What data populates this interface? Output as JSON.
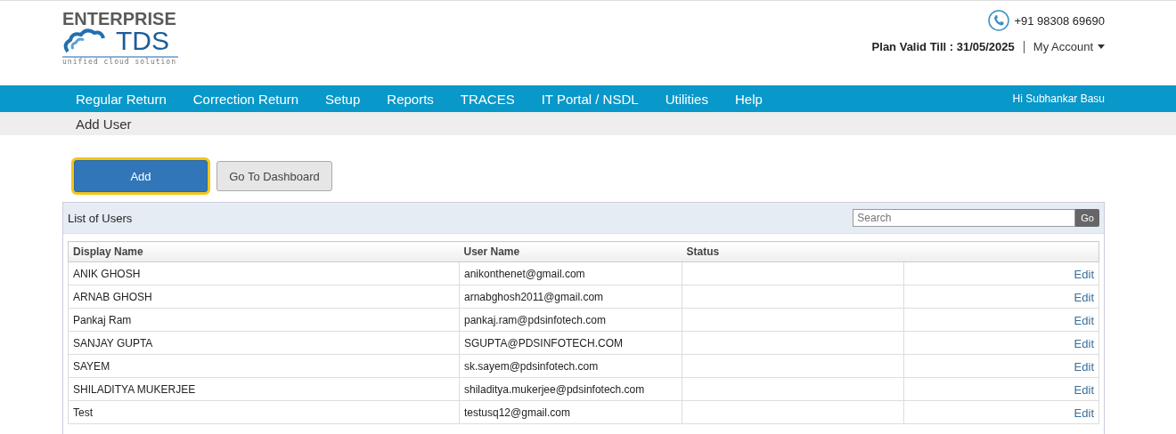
{
  "logo": {
    "line_1": "ENTERPRISE",
    "line_2": "TDS",
    "tagline": "unified cloud solution"
  },
  "contact": {
    "phone": "+91 98308 69690",
    "plan": "Plan Valid Till : 31/05/2025",
    "account": "My Account"
  },
  "nav": {
    "items": [
      "Regular Return",
      "Correction Return",
      "Setup",
      "Reports",
      "TRACES",
      "IT Portal / NSDL",
      "Utilities",
      "Help"
    ],
    "greeting": "Hi Subhankar Basu"
  },
  "breadcrumb": "Add User",
  "buttons": [
    {
      "label": "Add",
      "kind": "primary",
      "highlighted": true
    },
    {
      "label": "Go To Dashboard",
      "kind": "default",
      "highlighted": false
    }
  ],
  "panel": {
    "title": "List of Users",
    "search_placeholder": "Search",
    "search_button": "Go"
  },
  "table": {
    "columns": [
      "Display Name",
      "User Name",
      "Status"
    ],
    "rows": [
      {
        "display_name": "ANIK GHOSH",
        "user_name": "anikonthenet@gmail.com",
        "action": "Edit"
      },
      {
        "display_name": "ARNAB GHOSH",
        "user_name": "arnabghosh2011@gmail.com",
        "action": "Edit"
      },
      {
        "display_name": "Pankaj Ram",
        "user_name": "pankaj.ram@pdsinfotech.com",
        "action": "Edit"
      },
      {
        "display_name": "SANJAY GUPTA",
        "user_name": "SGUPTA@PDSINFOTECH.COM",
        "action": "Edit"
      },
      {
        "display_name": "SAYEM",
        "user_name": "sk.sayem@pdsinfotech.com",
        "action": "Edit"
      },
      {
        "display_name": "SHILADITYA MUKERJEE",
        "user_name": "shiladitya.mukerjee@pdsinfotech.com",
        "action": "Edit"
      },
      {
        "display_name": "Test",
        "user_name": "testusq12@gmail.com",
        "action": "Edit"
      }
    ]
  }
}
